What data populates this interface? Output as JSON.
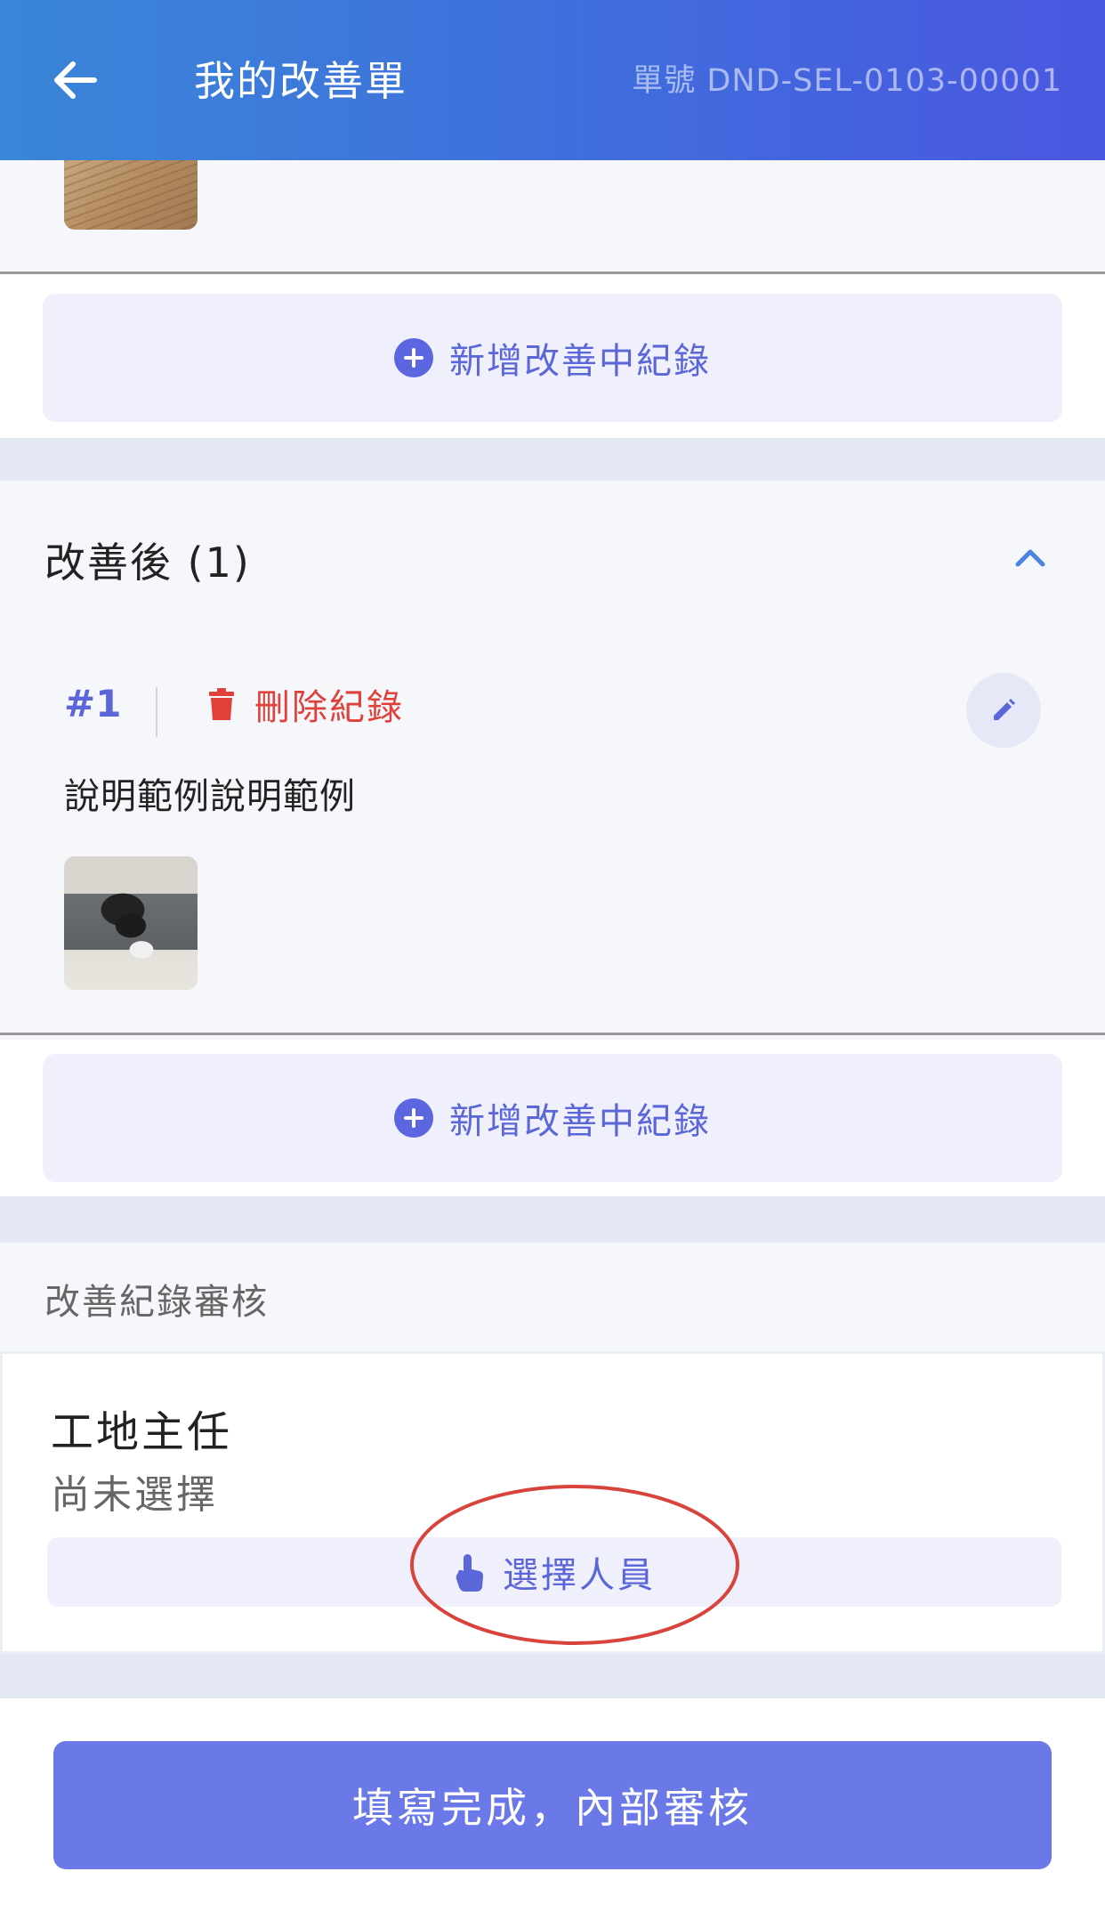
{
  "header": {
    "title": "我的改善單",
    "order_number": "單號 DND-SEL-0103-00001"
  },
  "in_progress": {
    "add_record_label": "新增改善中紀錄"
  },
  "after": {
    "title": "改善後 (1)",
    "records": [
      {
        "number": "#1",
        "delete_label": "刪除紀錄",
        "description": "說明範例說明範例"
      }
    ],
    "add_record_label": "新增改善中紀錄"
  },
  "audit": {
    "section_title": "改善紀錄審核",
    "role": "工地主任",
    "status": "尚未選擇",
    "select_label": "選擇人員"
  },
  "submit_label": "填寫完成，內部審核",
  "colors": {
    "accent": "#5b66d8",
    "danger": "#e0413a",
    "submit": "#6b79e8",
    "annotation": "#d8443c"
  }
}
